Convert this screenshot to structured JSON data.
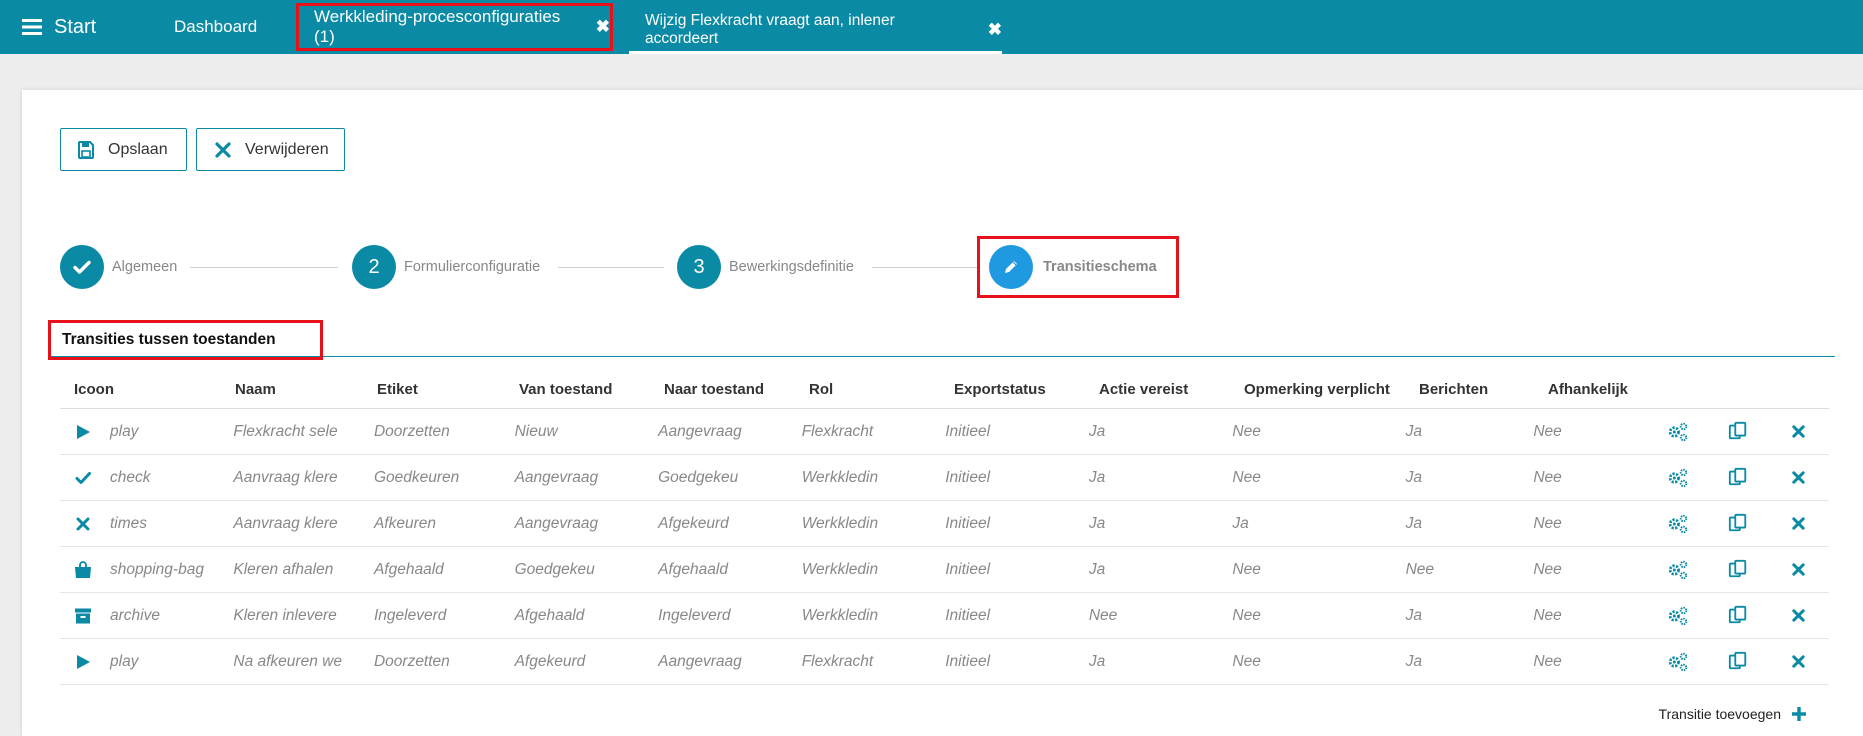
{
  "topbar": {
    "start_label": "Start",
    "tabs": [
      {
        "label": "Dashboard"
      },
      {
        "label": "Werkkleding-procesconfiguraties (1)"
      },
      {
        "label": "Wijzig Flexkracht vraagt aan, inlener accordeert"
      }
    ]
  },
  "toolbar": {
    "save_label": "Opslaan",
    "delete_label": "Verwijderen"
  },
  "wizard": {
    "steps": [
      {
        "number": "",
        "label": "Algemeen",
        "state": "done"
      },
      {
        "number": "2",
        "label": "Formulierconfiguratie",
        "state": "todo"
      },
      {
        "number": "3",
        "label": "Bewerkingsdefinitie",
        "state": "todo"
      },
      {
        "number": "",
        "label": "Transitieschema",
        "state": "active"
      }
    ]
  },
  "section": {
    "title": "Transities tussen toestanden"
  },
  "table": {
    "headers": [
      "Icoon",
      "Naam",
      "Etiket",
      "Van toestand",
      "Naar toestand",
      "Rol",
      "Exportstatus",
      "Actie vereist",
      "Opmerking verplicht",
      "Berichten",
      "Afhankelijk"
    ],
    "rows": [
      {
        "icon": "play",
        "naam": "Flexkracht sele",
        "etiket": "Doorzetten",
        "van": "Nieuw",
        "naar": "Aangevraag",
        "rol": "Flexkracht",
        "export": "Initieel",
        "actie": "Ja",
        "opmerking": "Nee",
        "berichten": "Ja",
        "afhankelijk": "Nee"
      },
      {
        "icon": "check",
        "naam": "Aanvraag klere",
        "etiket": "Goedkeuren",
        "van": "Aangevraag",
        "naar": "Goedgekeu",
        "rol": "Werkkledin",
        "export": "Initieel",
        "actie": "Ja",
        "opmerking": "Nee",
        "berichten": "Ja",
        "afhankelijk": "Nee"
      },
      {
        "icon": "times",
        "naam": "Aanvraag klere",
        "etiket": "Afkeuren",
        "van": "Aangevraag",
        "naar": "Afgekeurd",
        "rol": "Werkkledin",
        "export": "Initieel",
        "actie": "Ja",
        "opmerking": "Ja",
        "berichten": "Ja",
        "afhankelijk": "Nee"
      },
      {
        "icon": "shopping-bag",
        "naam": "Kleren afhalen",
        "etiket": "Afgehaald",
        "van": "Goedgekeu",
        "naar": "Afgehaald",
        "rol": "Werkkledin",
        "export": "Initieel",
        "actie": "Ja",
        "opmerking": "Nee",
        "berichten": "Nee",
        "afhankelijk": "Nee"
      },
      {
        "icon": "archive",
        "naam": "Kleren inlevere",
        "etiket": "Ingeleverd",
        "van": "Afgehaald",
        "naar": "Ingeleverd",
        "rol": "Werkkledin",
        "export": "Initieel",
        "actie": "Nee",
        "opmerking": "Nee",
        "berichten": "Ja",
        "afhankelijk": "Nee"
      },
      {
        "icon": "play",
        "naam": "Na afkeuren we",
        "etiket": "Doorzetten",
        "van": "Afgekeurd",
        "naar": "Aangevraag",
        "rol": "Flexkracht",
        "export": "Initieel",
        "actie": "Ja",
        "opmerking": "Nee",
        "berichten": "Ja",
        "afhankelijk": "Nee"
      }
    ],
    "add_label": "Transitie toevoegen"
  },
  "colors": {
    "primary": "#0a8aa5",
    "active_step": "#1f9ae0",
    "highlight": "#e8101a"
  }
}
